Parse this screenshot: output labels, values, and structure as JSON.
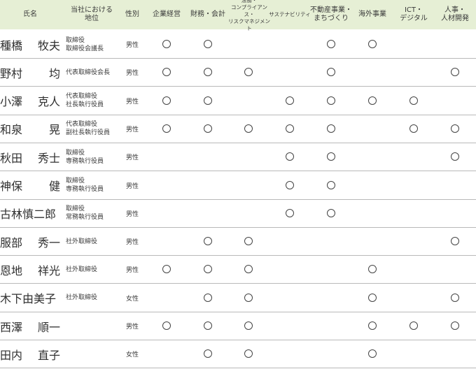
{
  "headers": {
    "name": "氏名",
    "title": "当社における\n地位",
    "gender": "性別",
    "skills": [
      "企業経営",
      "財務・会計",
      "法務・\nコンプライアンス・\nリスクマネジメント",
      "サステナビリティ",
      "不動産事業・\nまちづくり",
      "海外事業",
      "ICT・\nデジタル",
      "人事・\n人材開発"
    ]
  },
  "mark_symbol": "○",
  "rows": [
    {
      "name_parts": [
        "種橋",
        "牧夫"
      ],
      "titles": [
        "取締役",
        "取締役会議長"
      ],
      "gender": "男性",
      "skills": [
        1,
        1,
        0,
        0,
        1,
        1,
        0,
        0
      ]
    },
    {
      "name_parts": [
        "野村",
        "均"
      ],
      "titles": [
        "代表取締役会長"
      ],
      "gender": "男性",
      "skills": [
        1,
        1,
        1,
        0,
        1,
        0,
        0,
        1
      ]
    },
    {
      "name_parts": [
        "小澤",
        "克人"
      ],
      "titles": [
        "代表取締役",
        "社長執行役員"
      ],
      "gender": "男性",
      "skills": [
        1,
        1,
        0,
        1,
        1,
        1,
        1,
        0
      ]
    },
    {
      "name_parts": [
        "和泉",
        "晃"
      ],
      "titles": [
        "代表取締役",
        "副社長執行役員"
      ],
      "gender": "男性",
      "skills": [
        1,
        1,
        1,
        1,
        1,
        0,
        1,
        1
      ]
    },
    {
      "name_parts": [
        "秋田",
        "秀士"
      ],
      "titles": [
        "取締役",
        "専務執行役員"
      ],
      "gender": "男性",
      "skills": [
        0,
        0,
        0,
        1,
        1,
        0,
        0,
        1
      ]
    },
    {
      "name_parts": [
        "神保",
        "健"
      ],
      "titles": [
        "取締役",
        "専務執行役員"
      ],
      "gender": "男性",
      "skills": [
        0,
        0,
        0,
        1,
        1,
        0,
        0,
        0
      ]
    },
    {
      "name_parts": [
        "古林慎二郎"
      ],
      "titles": [
        "取締役",
        "常務執行役員"
      ],
      "gender": "男性",
      "skills": [
        0,
        0,
        0,
        1,
        1,
        0,
        0,
        0
      ]
    },
    {
      "name_parts": [
        "服部",
        "秀一"
      ],
      "titles": [
        "社外取締役"
      ],
      "gender": "男性",
      "skills": [
        0,
        1,
        1,
        0,
        0,
        0,
        0,
        1
      ]
    },
    {
      "name_parts": [
        "恩地",
        "祥光"
      ],
      "titles": [
        "社外取締役"
      ],
      "gender": "男性",
      "skills": [
        1,
        1,
        1,
        0,
        0,
        1,
        0,
        0
      ]
    },
    {
      "name_parts": [
        "木下由美子"
      ],
      "titles": [
        "社外取締役"
      ],
      "gender": "女性",
      "skills": [
        0,
        1,
        1,
        0,
        0,
        1,
        0,
        1
      ]
    },
    {
      "name_parts": [
        "西澤",
        "順一"
      ],
      "titles": [],
      "gender": "男性",
      "skills": [
        1,
        1,
        1,
        0,
        0,
        1,
        1,
        1
      ]
    },
    {
      "name_parts": [
        "田内",
        "直子"
      ],
      "titles": [],
      "gender": "女性",
      "skills": [
        0,
        1,
        1,
        0,
        0,
        1,
        0,
        0
      ]
    }
  ]
}
